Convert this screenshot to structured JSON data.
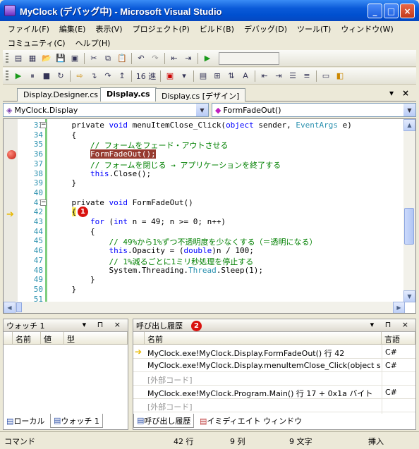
{
  "window": {
    "title": "MyClock (デバッグ中) - Microsoft Visual Studio",
    "buttons": {
      "minimize": "_",
      "maximize": "□",
      "close": "×"
    }
  },
  "menu": {
    "row1": [
      "ファイル(F)",
      "編集(E)",
      "表示(V)",
      "プロジェクト(P)",
      "ビルド(B)",
      "デバッグ(D)",
      "ツール(T)",
      "ウィンドウ(W)"
    ],
    "row2": [
      "コミュニティ(C)",
      "ヘルプ(H)"
    ]
  },
  "toolbar": {
    "hex_label": "16 進"
  },
  "tabs": [
    "Display.Designer.cs",
    "Display.cs",
    "Display.cs [デザイン]"
  ],
  "nav": {
    "class": "MyClock.Display",
    "member": "FormFadeOut()"
  },
  "code": {
    "lines": [
      {
        "n": "33",
        "parts": [
          [
            "    private ",
            "t"
          ],
          [
            "void",
            "k"
          ],
          [
            " menuItemClose_Click(",
            "t"
          ],
          [
            "object",
            "k"
          ],
          [
            " sender, ",
            "t"
          ],
          [
            "EventArgs",
            "y"
          ],
          [
            " e)",
            "t"
          ]
        ]
      },
      {
        "n": "34",
        "parts": [
          [
            "    {",
            "t"
          ]
        ]
      },
      {
        "n": "35",
        "parts": [
          [
            "        // フォームをフェード・アウトさせる",
            "c"
          ]
        ]
      },
      {
        "n": "36",
        "parts": [
          [
            "        ",
            "t"
          ],
          [
            "FormFadeOut();",
            "b"
          ]
        ]
      },
      {
        "n": "37",
        "parts": [
          [
            "        // フォームを閉じる → アプリケーションを終了する",
            "c"
          ]
        ]
      },
      {
        "n": "38",
        "parts": [
          [
            "        ",
            "t"
          ],
          [
            "this",
            "k"
          ],
          [
            ".Close();",
            "t"
          ]
        ]
      },
      {
        "n": "39",
        "parts": [
          [
            "    }",
            "t"
          ]
        ]
      },
      {
        "n": "40",
        "parts": [
          [
            "",
            "t"
          ]
        ]
      },
      {
        "n": "41",
        "parts": [
          [
            "    private ",
            "t"
          ],
          [
            "void",
            "k"
          ],
          [
            " FormFadeOut()",
            "t"
          ]
        ]
      },
      {
        "n": "42",
        "parts": [
          [
            "    ",
            "t"
          ],
          [
            "{",
            "h"
          ]
        ]
      },
      {
        "n": "43",
        "parts": [
          [
            "        ",
            "t"
          ],
          [
            "for",
            "k"
          ],
          [
            " (",
            "t"
          ],
          [
            "int",
            "k"
          ],
          [
            " n = 49; n >= 0; n++)",
            "t"
          ]
        ]
      },
      {
        "n": "44",
        "parts": [
          [
            "        {",
            "t"
          ]
        ]
      },
      {
        "n": "45",
        "parts": [
          [
            "            // 49%から1%ずつ不透明度を少なくする（＝透明になる）",
            "c"
          ]
        ]
      },
      {
        "n": "46",
        "parts": [
          [
            "            ",
            "t"
          ],
          [
            "this",
            "k"
          ],
          [
            ".Opacity = (",
            "t"
          ],
          [
            "double",
            "k"
          ],
          [
            ")n / 100;",
            "t"
          ]
        ]
      },
      {
        "n": "47",
        "parts": [
          [
            "            // 1%減るごとに1ミリ秒処理を停止する",
            "c"
          ]
        ]
      },
      {
        "n": "48",
        "parts": [
          [
            "            System.Threading.",
            "t"
          ],
          [
            "Thread",
            "y"
          ],
          [
            ".Sleep(1);",
            "t"
          ]
        ]
      },
      {
        "n": "49",
        "parts": [
          [
            "        }",
            "t"
          ]
        ]
      },
      {
        "n": "50",
        "parts": [
          [
            "    }",
            "t"
          ]
        ]
      },
      {
        "n": "51",
        "parts": [
          [
            "",
            "t"
          ]
        ]
      }
    ]
  },
  "callouts": {
    "one": "1",
    "two": "2"
  },
  "watch": {
    "title": "ウォッチ 1",
    "columns": [
      "名前",
      "値",
      "型"
    ]
  },
  "callstack": {
    "title": "呼び出し履歴",
    "columns": [
      "名前",
      "言語"
    ],
    "rows": [
      {
        "name": "MyClock.exe!MyClock.Display.FormFadeOut() 行 42",
        "lang": "C#",
        "current": true,
        "external": false
      },
      {
        "name": "MyClock.exe!MyClock.Display.menuItemClose_Click(object sender = {",
        "lang": "C#",
        "current": false,
        "external": false
      },
      {
        "name": "[外部コード]",
        "lang": "",
        "current": false,
        "external": true
      },
      {
        "name": "MyClock.exe!MyClock.Program.Main() 行 17 + 0x1a バイト",
        "lang": "C#",
        "current": false,
        "external": false
      },
      {
        "name": "[外部コード]",
        "lang": "",
        "current": false,
        "external": true
      }
    ]
  },
  "bottom_tabs_left": [
    "ローカル",
    "ウォッチ 1"
  ],
  "bottom_tabs_right": [
    "呼び出し履歴",
    "イミディエイト ウィンドウ"
  ],
  "status": {
    "mode": "コマンド",
    "line": "42 行",
    "col": "9 列",
    "ch": "9 文字",
    "ins": "挿入"
  },
  "panel_ctl": "▾ ⊓ ×"
}
